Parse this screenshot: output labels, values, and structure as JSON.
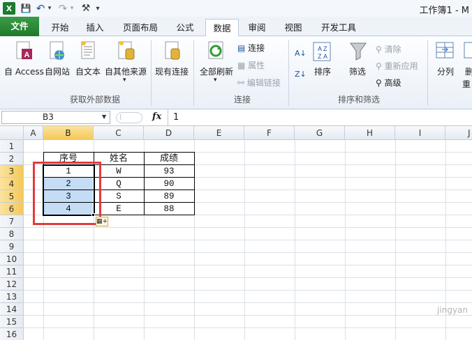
{
  "window": {
    "title": "工作簿1 - M"
  },
  "qa_toolbar": {
    "save": "💾",
    "undo": "↶",
    "redo": "↷",
    "extra": "⚒",
    "more": "▾"
  },
  "tabs": [
    {
      "label": "文件"
    },
    {
      "label": "开始"
    },
    {
      "label": "插入"
    },
    {
      "label": "页面布局"
    },
    {
      "label": "公式"
    },
    {
      "label": "数据"
    },
    {
      "label": "审阅"
    },
    {
      "label": "视图"
    },
    {
      "label": "开发工具"
    }
  ],
  "ribbon": {
    "get_external": {
      "buttons": [
        "自 Access",
        "自网站",
        "自文本",
        "自其他来源"
      ],
      "existing": "现有连接",
      "group": "获取外部数据"
    },
    "connections": {
      "refresh_all": "全部刷新",
      "connections": "连接",
      "properties": "属性",
      "edit_links": "编辑链接",
      "group": "连接"
    },
    "sort_filter": {
      "sort": "排序",
      "filter": "筛选",
      "clear": "清除",
      "reapply": "重新应用",
      "advanced": "高级",
      "group": "排序和筛选"
    },
    "tools": {
      "split": "分列",
      "remove_dup": "删",
      "dup_sub": "重"
    }
  },
  "formula_bar": {
    "name_box": "B3",
    "fx": "fx",
    "value": "1"
  },
  "columns": [
    "A",
    "B",
    "C",
    "D",
    "E",
    "F",
    "G",
    "H",
    "I",
    "J"
  ],
  "rows": [
    "1",
    "2",
    "3",
    "4",
    "5",
    "6",
    "7",
    "8",
    "9",
    "10",
    "11",
    "12",
    "13",
    "14",
    "15",
    "16"
  ],
  "table": {
    "headers": [
      "序号",
      "姓名",
      "成绩"
    ],
    "rows": [
      [
        "1",
        "W",
        "93"
      ],
      [
        "2",
        "Q",
        "90"
      ],
      [
        "3",
        "S",
        "89"
      ],
      [
        "4",
        "E",
        "88"
      ]
    ]
  },
  "watermark": "jingyan"
}
